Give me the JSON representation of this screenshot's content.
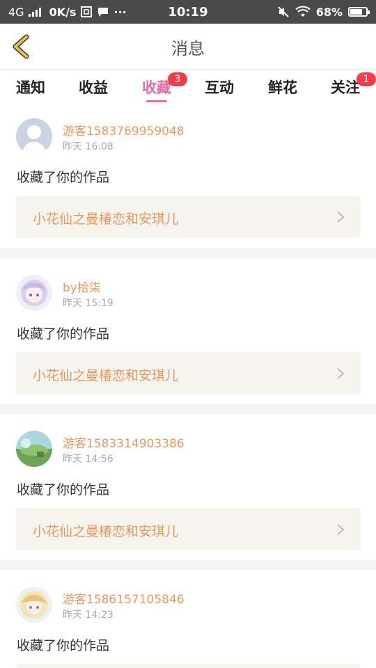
{
  "status_bar": {
    "network": "4G",
    "speed": "0K/s",
    "time": "10:19",
    "battery": "68%"
  },
  "header": {
    "title": "消息",
    "back_icon": "chevron-left-icon",
    "accent_color": "#e6c34a"
  },
  "tabs": [
    {
      "label": "通知",
      "badge": ""
    },
    {
      "label": "收益",
      "badge": ""
    },
    {
      "label": "收藏",
      "badge": "3",
      "active": true
    },
    {
      "label": "互动",
      "badge": ""
    },
    {
      "label": "鲜花",
      "badge": ""
    },
    {
      "label": "关注",
      "badge": "1"
    }
  ],
  "messages": [
    {
      "user": "游客1583769959048",
      "time": "昨天 16:08",
      "action": "收藏了你的作品",
      "work": "小花仙之曼椿恋和安琪儿",
      "avatar": "default-avatar"
    },
    {
      "user": "by拾柒",
      "time": "昨天 15:19",
      "action": "收藏了你的作品",
      "work": "小花仙之曼椿恋和安琪儿",
      "avatar": "anime-girl-avatar"
    },
    {
      "user": "游客1583314903386",
      "time": "昨天 14:56",
      "action": "收藏了你的作品",
      "work": "小花仙之曼椿恋和安琪儿",
      "avatar": "landscape-avatar"
    },
    {
      "user": "游客1586157105846",
      "time": "昨天 14:23",
      "action": "收藏了你的作品",
      "work": "",
      "avatar": "fairy-avatar"
    }
  ],
  "colors": {
    "active_tab": "#e46da3",
    "badge": "#f23c4a",
    "username": "#e9975c"
  }
}
